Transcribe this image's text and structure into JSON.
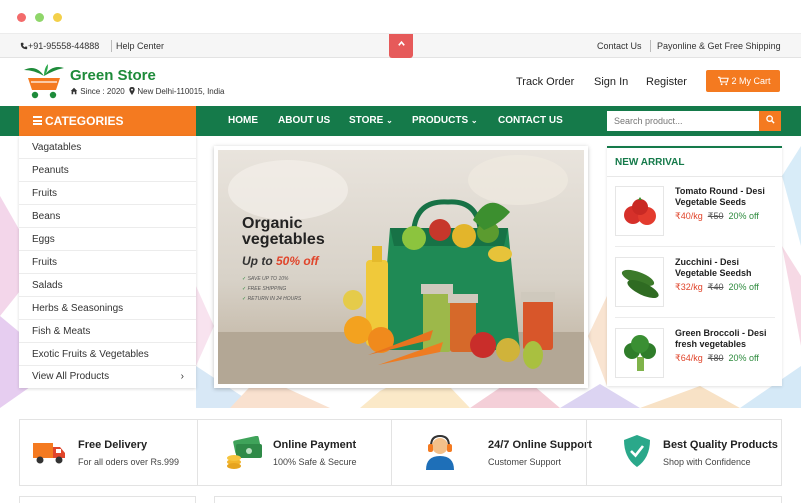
{
  "topbar": {
    "phone": "+91-95558-44888",
    "help": "Help Center",
    "contact": "Contact Us",
    "payonline": "Payonline & Get Free Shipping",
    "phone_icon": "phone-icon",
    "scroll_up_icon": "chevron-up-icon"
  },
  "header": {
    "store_name": "Green Store",
    "since": "Since : 2020",
    "location": "New Delhi-110015, India",
    "track": "Track Order",
    "signin": "Sign In",
    "register": "Register",
    "cart": "2 My Cart",
    "logo_icon": "cart-leaf-logo"
  },
  "nav": {
    "categories": "CATEGORIES",
    "home": "HOME",
    "about": "ABOUT US",
    "store": "STORE",
    "products": "PRODUCTS",
    "contact": "CONTACT US",
    "search_placeholder": "Search product..."
  },
  "categories": [
    "Vagatables",
    "Peanuts",
    "Fruits",
    "Beans",
    "Eggs",
    "Fruits",
    "Salads",
    "Herbs & Seasonings",
    "Fish & Meats",
    "Exotic Fruits & Vegetables",
    "View All Products"
  ],
  "banner": {
    "title_line1": "Organic",
    "title_line2": "vegetables",
    "offer_prefix": "Up to",
    "offer_value": "50% off",
    "features": [
      "SAVE UP TO 10%",
      "FREE SHIPPING",
      "RETURN IN 24 HOURS"
    ]
  },
  "new_arrival": {
    "title": "NEW ARRIVAL",
    "products": [
      {
        "name": "Tomato Round - Desi Vegetable Seeds",
        "price": "₹40/kg",
        "old_price": "₹50",
        "discount": "20% off"
      },
      {
        "name": "Zucchini - Desi Vegetable Seedsh",
        "price": "₹32/kg",
        "old_price": "₹40",
        "discount": "20% off"
      },
      {
        "name": "Green Broccoli - Desi fresh vegetables",
        "price": "₹64/kg",
        "old_price": "₹80",
        "discount": "20% off"
      }
    ]
  },
  "features": [
    {
      "title": "Free Delivery",
      "subtitle": "For all oders over Rs.999",
      "icon": "truck-icon"
    },
    {
      "title": "Online Payment",
      "subtitle": "100% Safe & Secure",
      "icon": "money-icon"
    },
    {
      "title": "24/7 Online Support",
      "subtitle": "Customer Support",
      "icon": "headset-icon"
    },
    {
      "title": "Best Quality Products",
      "subtitle": "Shop with Confidence",
      "icon": "shield-check-icon"
    }
  ],
  "colors": {
    "brand_green": "#157a4a",
    "accent_orange": "#f47a20",
    "price_red": "#e0452b",
    "discount_green": "#2c8a3c"
  }
}
